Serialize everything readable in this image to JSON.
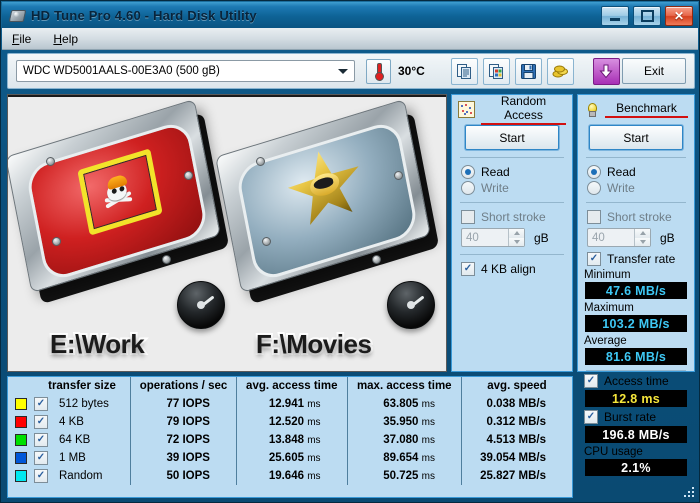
{
  "window": {
    "title": "HD Tune Pro 4.60 - Hard Disk Utility",
    "icon": "hard-disk-icon",
    "buttons": {
      "minimize": "–",
      "maximize": "□",
      "close": "✕"
    }
  },
  "menu": {
    "items": [
      {
        "label": "File",
        "mnemonic": "F"
      },
      {
        "label": "Help",
        "mnemonic": "H"
      }
    ]
  },
  "toolbar": {
    "drive_selector": {
      "value": "WDC WD5001AALS-00E3A0 (500 gB)",
      "icon": "chevron-down-icon"
    },
    "temperature": {
      "icon": "thermometer-icon",
      "value": "30°C"
    },
    "icon_buttons": [
      {
        "name": "copy-text-icon",
        "label": "Copy to clipboard (text)"
      },
      {
        "name": "copy-image-icon",
        "label": "Copy to clipboard (image)"
      },
      {
        "name": "save-floppy-icon",
        "label": "Save"
      },
      {
        "name": "gold-coins-icon",
        "label": "Options"
      },
      {
        "name": "download-arrow-icon",
        "label": "Download"
      }
    ],
    "exit_label": "Exit"
  },
  "graph": {
    "drives": [
      {
        "label": "E:\\Work",
        "sticker": "skull-hardhat-sticker",
        "platter_color": "#cf2020"
      },
      {
        "label": "F:\\Movies",
        "sticker": "gold-star-sticker",
        "platter_color": "#93aebf"
      }
    ],
    "gauge_icon": "speed-gauge-icon"
  },
  "panels": {
    "random_access": {
      "title": "Random Access",
      "icon": "scatter-plot-icon",
      "start_label": "Start",
      "mode": {
        "read_label": "Read",
        "write_label": "Write",
        "selected": "Read"
      },
      "short_stroke": {
        "label": "Short stroke",
        "checked": false,
        "value": "40",
        "unit": "gB"
      },
      "align": {
        "label": "4 KB align",
        "checked": true
      }
    },
    "benchmark": {
      "title": "Benchmark",
      "icon": "lightbulb-icon",
      "start_label": "Start",
      "mode": {
        "read_label": "Read",
        "write_label": "Write",
        "selected": "Read"
      },
      "short_stroke": {
        "label": "Short stroke",
        "checked": false,
        "value": "40",
        "unit": "gB"
      },
      "transfer_rate": {
        "label": "Transfer rate",
        "checked": true
      },
      "minimum": {
        "label": "Minimum",
        "value": "47.6 MB/s",
        "color": "#3ec8f5"
      },
      "maximum": {
        "label": "Maximum",
        "value": "103.2 MB/s",
        "color": "#3ec8f5"
      },
      "average": {
        "label": "Average",
        "value": "81.6 MB/s",
        "color": "#3ec8f5"
      },
      "access_time": {
        "label": "Access time",
        "checked": true,
        "value": "12.8 ms",
        "color": "#f6e63b"
      },
      "burst_rate": {
        "label": "Burst rate",
        "checked": true,
        "value": "196.8 MB/s",
        "color": "#ffffff"
      },
      "cpu_usage": {
        "label": "CPU usage",
        "value": "2.1%",
        "color": "#ffffff"
      }
    }
  },
  "results_table": {
    "columns": [
      "",
      "transfer size",
      "operations / sec",
      "avg. access time",
      "max. access time",
      "avg. speed"
    ],
    "rows": [
      {
        "color": "#ffff00",
        "checked": true,
        "size": "512 bytes",
        "iops": "77 IOPS",
        "avg_access": "12.941 ms",
        "max_access": "63.805 ms",
        "avg_speed": "0.038 MB/s"
      },
      {
        "color": "#ff0000",
        "checked": true,
        "size": "4 KB",
        "iops": "79 IOPS",
        "avg_access": "12.520 ms",
        "max_access": "35.950 ms",
        "avg_speed": "0.312 MB/s"
      },
      {
        "color": "#00e000",
        "checked": true,
        "size": "64 KB",
        "iops": "72 IOPS",
        "avg_access": "13.848 ms",
        "max_access": "37.080 ms",
        "avg_speed": "4.513 MB/s"
      },
      {
        "color": "#0057d8",
        "checked": true,
        "size": "1 MB",
        "iops": "39 IOPS",
        "avg_access": "25.605 ms",
        "max_access": "89.654 ms",
        "avg_speed": "39.054 MB/s"
      },
      {
        "color": "#00e8f0",
        "checked": true,
        "size": "Random",
        "iops": "50 IOPS",
        "avg_access": "19.646 ms",
        "max_access": "50.725 ms",
        "avg_speed": "25.827 MB/s"
      }
    ]
  }
}
